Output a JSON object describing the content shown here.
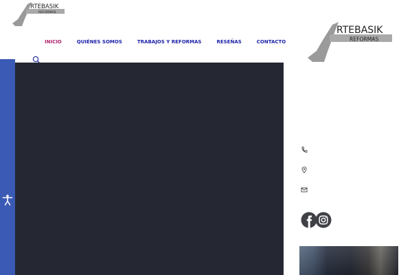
{
  "header": {
    "logo": {
      "line1": "RTEBASIK",
      "line2": "REFORMAS"
    },
    "nav": [
      {
        "label": "INICIO",
        "active": true
      },
      {
        "label": "QUIÉNES SOMOS",
        "active": false
      },
      {
        "label": "TRABAJOS Y REFORMAS",
        "active": false
      },
      {
        "label": "RESEÑAS",
        "active": false
      },
      {
        "label": "CONTACTO",
        "active": false
      }
    ],
    "search_icon": "search-icon"
  },
  "accessibility": {
    "icon": "accessibility-icon",
    "color": "#3b5ab5"
  },
  "sidebar": {
    "logo": {
      "line1": "RTEBASIK",
      "line2": "REFORMAS"
    },
    "contact_icons": [
      "phone-icon",
      "location-icon",
      "email-icon"
    ],
    "social_icons": [
      "facebook-icon",
      "instagram-icon"
    ]
  },
  "colors": {
    "nav_link": "#1e24a8",
    "nav_active": "#b0246e",
    "hero_bg": "#252832",
    "icon": "#3f4147"
  }
}
